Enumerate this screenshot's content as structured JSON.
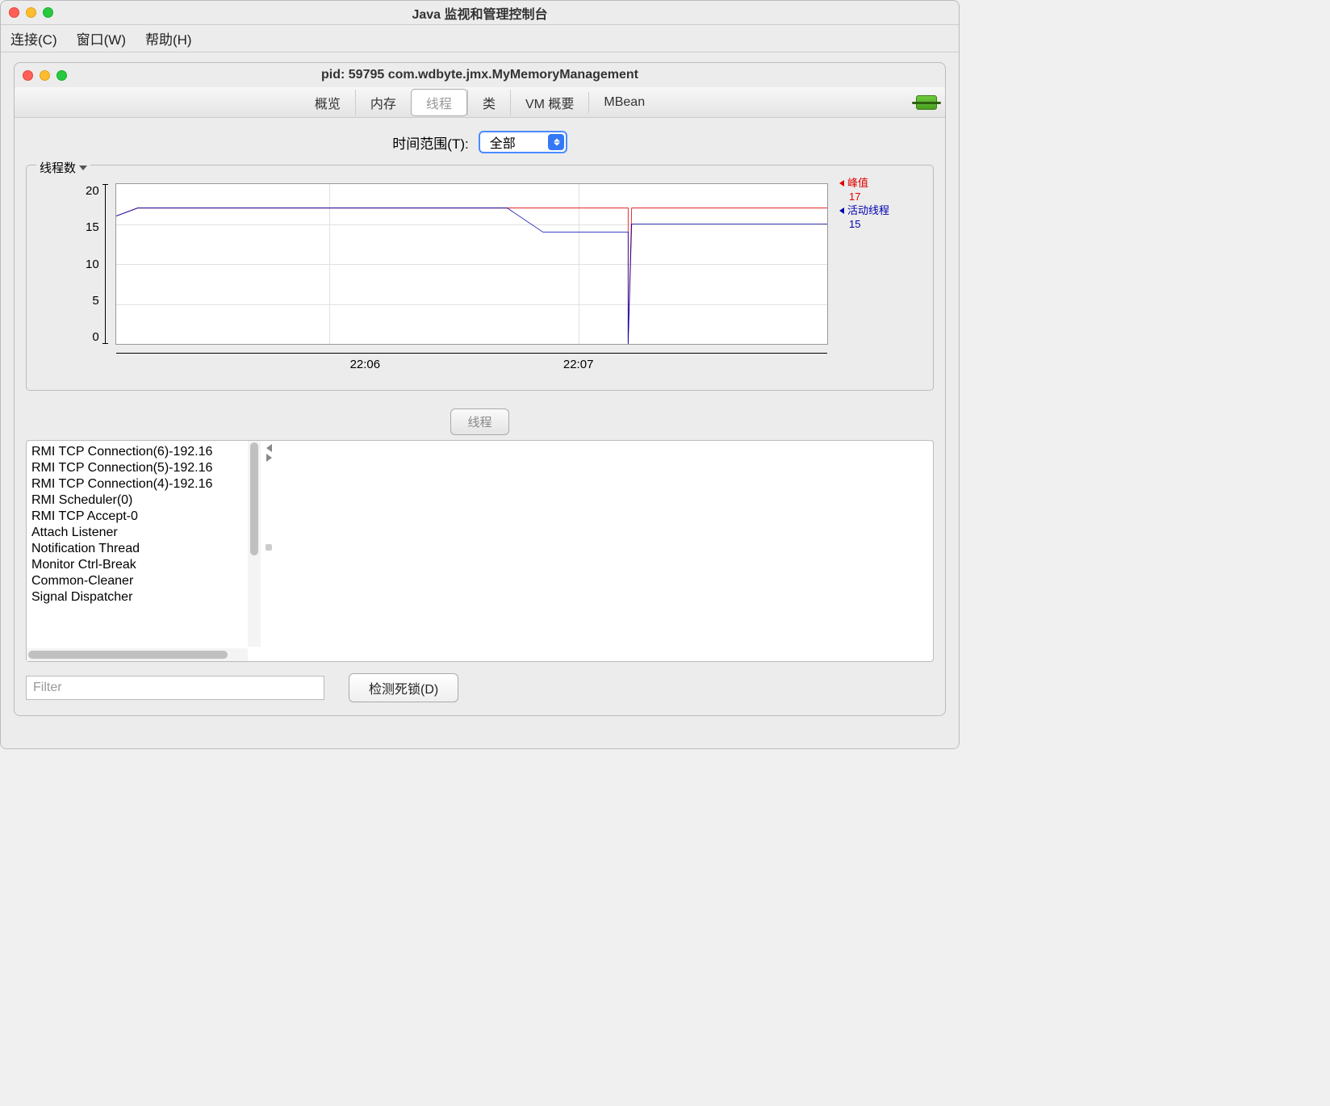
{
  "outer_window_title": "Java 监视和管理控制台",
  "menubar": {
    "items": [
      "连接(C)",
      "窗口(W)",
      "帮助(H)"
    ]
  },
  "inner_window_title": "pid: 59795 com.wdbyte.jmx.MyMemoryManagement",
  "tabs": [
    "概览",
    "内存",
    "线程",
    "类",
    "VM 概要",
    "MBean"
  ],
  "active_tab_index": 2,
  "time_range": {
    "label": "时间范围(T):",
    "value": "全部"
  },
  "chart": {
    "panel_title": "线程数",
    "legend": {
      "peak_label": "峰值",
      "peak_value": "17",
      "live_label": "活动线程",
      "live_value": "15"
    }
  },
  "center_button": "线程",
  "thread_list": [
    "RMI TCP Connection(6)-192.16",
    "RMI TCP Connection(5)-192.16",
    "RMI TCP Connection(4)-192.16",
    "RMI Scheduler(0)",
    "RMI TCP Accept-0",
    "Attach Listener",
    "Notification Thread",
    "Monitor Ctrl-Break",
    "Common-Cleaner",
    "Signal Dispatcher"
  ],
  "filter_placeholder": "Filter",
  "deadlock_button": "检测死锁(D)",
  "chart_data": {
    "type": "line",
    "ylabel": "线程数",
    "ylim": [
      0,
      20
    ],
    "yticks": [
      0,
      5,
      10,
      15,
      20
    ],
    "xticks": [
      "22:06",
      "22:07"
    ],
    "series": [
      {
        "name": "峰值",
        "color": "#e00000",
        "points": [
          [
            0,
            16
          ],
          [
            3,
            17
          ],
          [
            72,
            17
          ],
          [
            72,
            0
          ],
          [
            72.5,
            17
          ],
          [
            100,
            17
          ]
        ]
      },
      {
        "name": "活动线程",
        "color": "#0000b0",
        "points": [
          [
            0,
            16
          ],
          [
            3,
            17
          ],
          [
            55,
            17
          ],
          [
            60,
            14
          ],
          [
            72,
            14
          ],
          [
            72,
            0
          ],
          [
            72.5,
            15
          ],
          [
            100,
            15
          ]
        ]
      }
    ]
  }
}
